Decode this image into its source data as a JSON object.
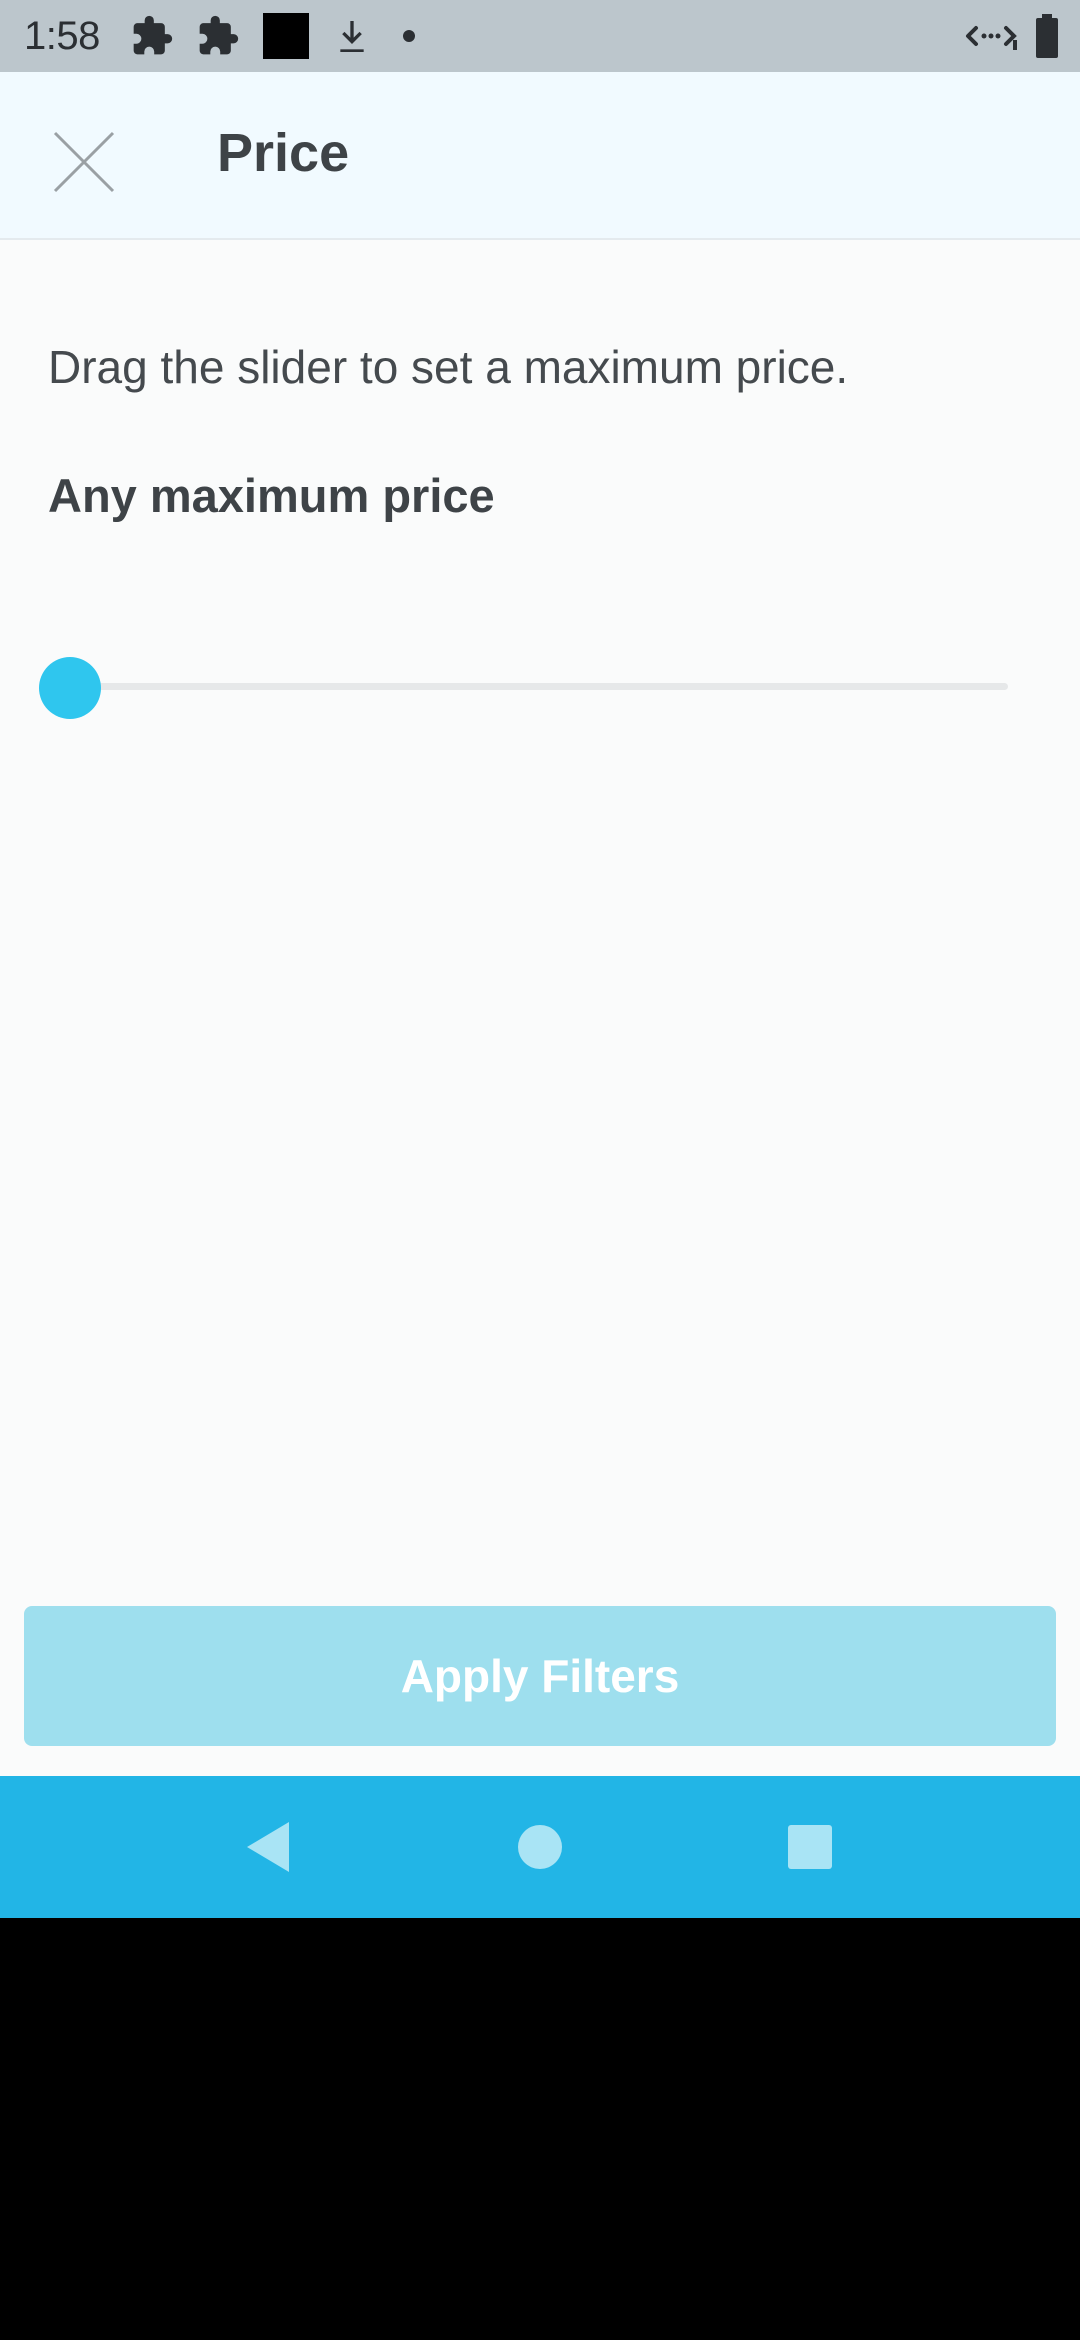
{
  "status_bar": {
    "time": "1:58",
    "icons": [
      "puzzle-icon",
      "puzzle-icon",
      "black-square-icon",
      "download-icon",
      "dot-icon"
    ],
    "right_icons": [
      "data-transfer-icon",
      "battery-icon"
    ]
  },
  "header": {
    "title": "Price",
    "close_icon": "close-icon"
  },
  "main": {
    "instruction": "Drag the slider to set a maximum price.",
    "price_label": "Any maximum price",
    "slider_value_fraction": 0
  },
  "footer": {
    "apply_label": "Apply Filters"
  },
  "nav": {
    "icons": [
      "back-icon",
      "home-icon",
      "recents-icon"
    ]
  },
  "colors": {
    "accent": "#2fc6ee",
    "apply_button_disabled": "#9edfee",
    "nav_bar": "#22b5e6",
    "status_bar": "#bcc6cc",
    "header_bg": "#f1faff"
  }
}
